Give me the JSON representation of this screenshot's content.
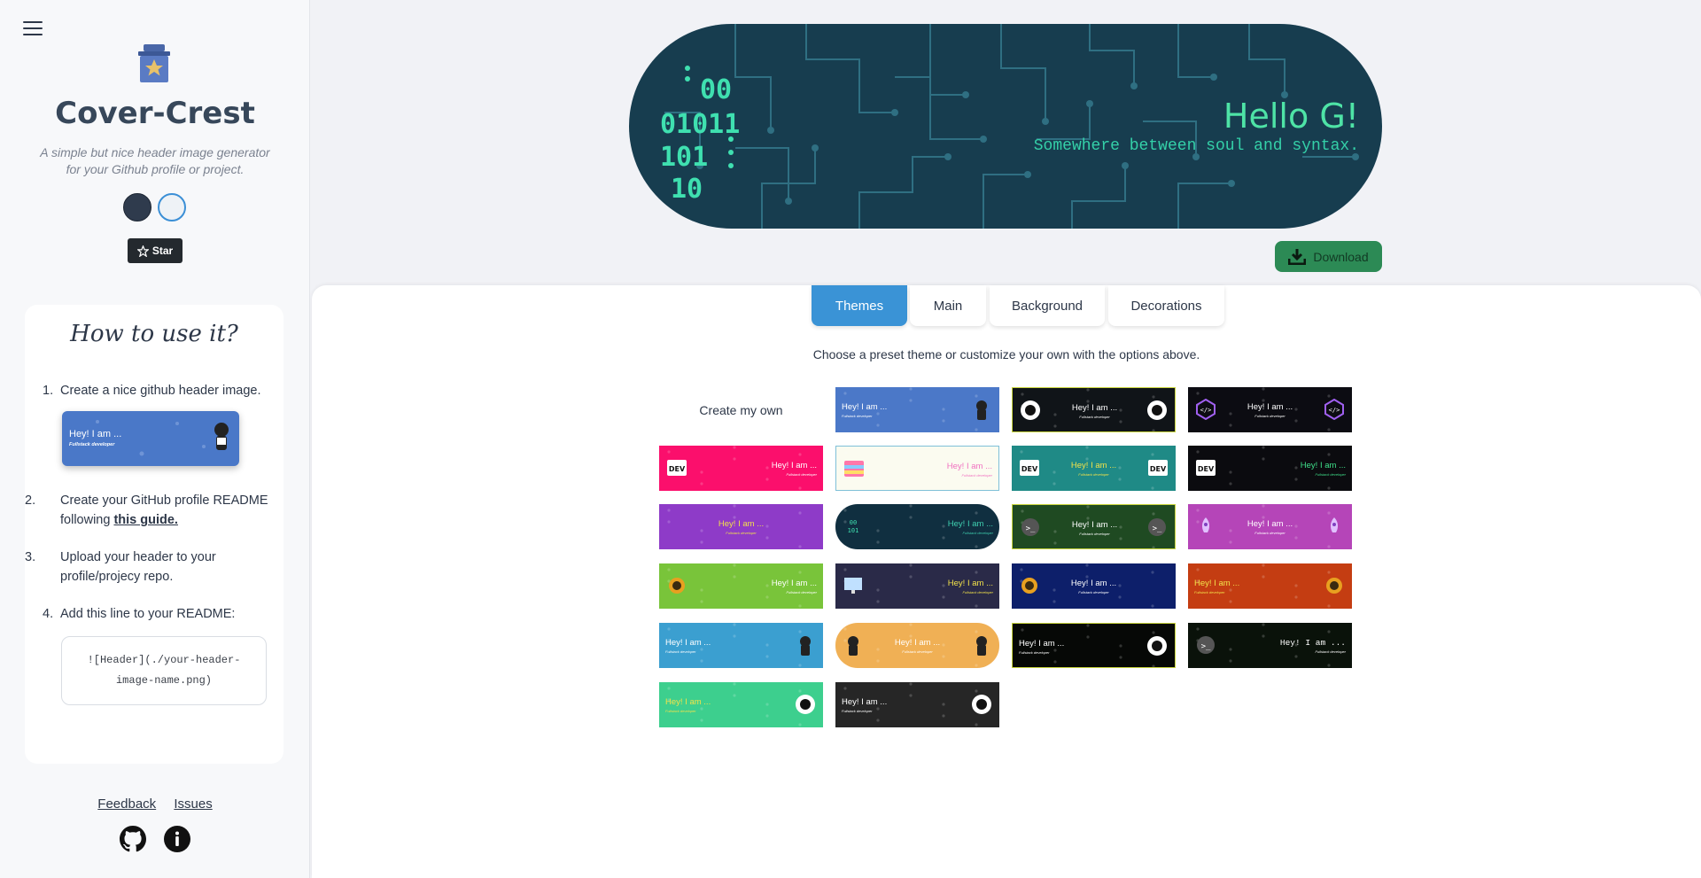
{
  "sidebar": {
    "brand": "Cover-Crest",
    "tagline": "A simple but nice header image generator for your Github profile or project.",
    "star_label": "Star",
    "howto": {
      "title": "How to use it?",
      "steps": [
        {
          "num": "1.",
          "text": "Create a nice github header image."
        },
        {
          "num": "2.",
          "text_before": "Create your GitHub profile README following ",
          "link": "this guide."
        },
        {
          "num": "3.",
          "text": "Upload your header to your profile/projecy repo."
        },
        {
          "num": "4.",
          "text": "Add this line to your README:"
        }
      ],
      "sample": {
        "title": "Hey! I am ...",
        "subtitle": "Fullstack developer"
      },
      "code": "![Header](./your-header-image-name.png)"
    },
    "footer": {
      "feedback": "Feedback",
      "issues": "Issues"
    }
  },
  "preview": {
    "title": "Hello G!",
    "subtitle": "Somewhere between soul and syntax.",
    "binary": [
      "00",
      "01011",
      "101",
      "10"
    ],
    "download_label": "Download"
  },
  "tabs": [
    "Themes",
    "Main",
    "Background",
    "Decorations"
  ],
  "hint": "Choose a preset theme or customize your own with the options above.",
  "create_own": "Create my own",
  "theme_text": {
    "title": "Hey! I am ...",
    "subtitle": "Fullstack developer"
  },
  "themes": [
    {
      "bg": "#4b78c8",
      "fg": "#ffffff",
      "align": "left",
      "icon": "octocat-icon",
      "icon_side": "right"
    },
    {
      "bg": "#101418",
      "fg": "#ffffff",
      "align": "center",
      "icon": "github-icon",
      "icon_side": "both",
      "border": "#c8d43c"
    },
    {
      "bg": "#0c0c12",
      "fg": "#ffffff",
      "align": "center",
      "icon": "code-hex-icon",
      "icon_side": "both"
    },
    {
      "bg": "#fb0f6c",
      "fg": "#ffffff",
      "align": "right",
      "icon": "dev-icon",
      "icon_side": "left"
    },
    {
      "bg": "#fbfbf0",
      "fg": "#f071c0",
      "align": "right",
      "icon": "dev-rainbow-icon",
      "icon_side": "left",
      "border": "#7fc0d8"
    },
    {
      "bg": "#1f8a86",
      "fg": "#f2e24a",
      "align": "center",
      "icon": "dev-icon",
      "icon_side": "both"
    },
    {
      "bg": "#0b0b0f",
      "fg": "#3fe08a",
      "align": "right",
      "icon": "dev-icon",
      "icon_side": "left"
    },
    {
      "bg": "#8e3bc8",
      "fg": "#f2e24a",
      "align": "center",
      "icon": "",
      "icon_side": "none"
    },
    {
      "bg": "#102f40",
      "fg": "#3fd0b0",
      "align": "right",
      "icon": "binary-icon",
      "icon_side": "left",
      "round": true
    },
    {
      "bg": "#1f4a22",
      "fg": "#ffffff",
      "align": "center",
      "icon": "terminal-icon",
      "icon_side": "both",
      "border": "#c8d43c"
    },
    {
      "bg": "#b545b8",
      "fg": "#ffffff",
      "align": "center",
      "icon": "rocket-icon",
      "icon_side": "both"
    },
    {
      "bg": "#79c43a",
      "fg": "#ffffff",
      "align": "right",
      "icon": "rust-icon",
      "icon_side": "left"
    },
    {
      "bg": "#2a2a48",
      "fg": "#f2e24a",
      "align": "right",
      "icon": "monitor-icon",
      "icon_side": "left"
    },
    {
      "bg": "#0d1f6a",
      "fg": "#ffffff",
      "align": "center",
      "icon": "rust-icon",
      "icon_side": "left"
    },
    {
      "bg": "#c43d12",
      "fg": "#f2e24a",
      "align": "left",
      "icon": "rust-icon",
      "icon_side": "right"
    },
    {
      "bg": "#3b9fd0",
      "fg": "#ffffff",
      "align": "left",
      "icon": "octocat-icon",
      "icon_side": "right"
    },
    {
      "bg": "#f0b055",
      "fg": "#ffffff",
      "align": "center",
      "icon": "octocat-icon",
      "icon_side": "both",
      "round": true
    },
    {
      "bg": "#060806",
      "fg": "#ffffff",
      "align": "left",
      "icon": "github-icon",
      "icon_side": "right",
      "border": "#c8d43c"
    },
    {
      "bg": "#0a120a",
      "fg": "#ffffff",
      "align": "right",
      "icon": "terminal-icon",
      "icon_side": "left",
      "mono": true
    },
    {
      "bg": "#3dcf8e",
      "fg": "#f2e24a",
      "align": "left",
      "icon": "github-icon",
      "icon_side": "right"
    },
    {
      "bg": "#262626",
      "fg": "#ffffff",
      "align": "left",
      "icon": "github-icon",
      "icon_side": "right"
    }
  ]
}
